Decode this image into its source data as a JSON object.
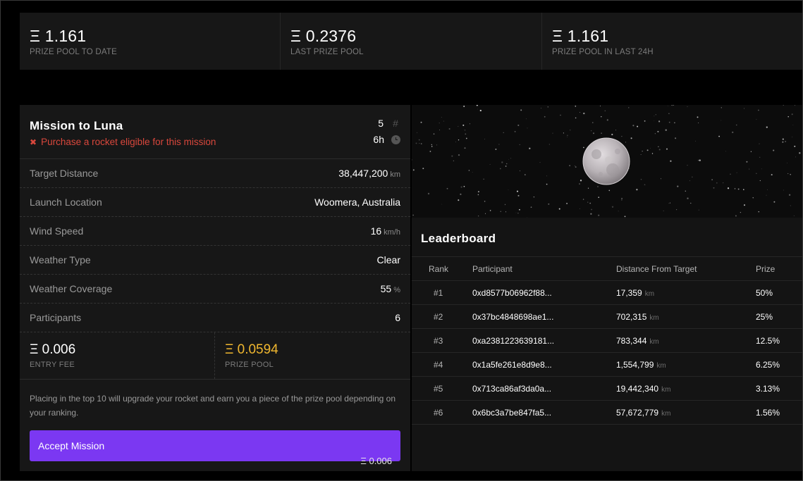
{
  "stats": [
    {
      "value": "Ξ 1.161",
      "label": "PRIZE POOL TO DATE"
    },
    {
      "value": "Ξ 0.2376",
      "label": "LAST PRIZE POOL"
    },
    {
      "value": "Ξ 1.161",
      "label": "PRIZE POOL IN LAST 24H"
    }
  ],
  "mission": {
    "title": "Mission to Luna",
    "warning": "Purchase a rocket eligible for this mission",
    "count": "5",
    "duration": "6h",
    "rows": [
      {
        "label": "Target Distance",
        "value": "38,447,200",
        "unit": "km"
      },
      {
        "label": "Launch Location",
        "value": "Woomera, Australia",
        "unit": ""
      },
      {
        "label": "Wind Speed",
        "value": "16",
        "unit": "km/h"
      },
      {
        "label": "Weather Type",
        "value": "Clear",
        "unit": ""
      },
      {
        "label": "Weather Coverage",
        "value": "55",
        "unit": "%"
      },
      {
        "label": "Participants",
        "value": "6",
        "unit": ""
      }
    ],
    "entry_fee": {
      "value": "Ξ 0.006",
      "label": "ENTRY FEE"
    },
    "prize_pool": {
      "value": "Ξ 0.0594",
      "label": "PRIZE POOL"
    },
    "description": "Placing in the top 10 will upgrade your rocket and earn you a piece of the prize pool depending on your ranking.",
    "accept_label": "Accept Mission",
    "accept_price": "Ξ 0.006"
  },
  "leaderboard": {
    "title": "Leaderboard",
    "columns": [
      "Rank",
      "Participant",
      "Distance From Target",
      "Prize"
    ],
    "rows": [
      {
        "rank": "#1",
        "participant": "0xd8577b06962f88...",
        "distance": "17,359",
        "unit": "km",
        "prize": "50%"
      },
      {
        "rank": "#2",
        "participant": "0x37bc4848698ae1...",
        "distance": "702,315",
        "unit": "km",
        "prize": "25%"
      },
      {
        "rank": "#3",
        "participant": "0xa2381223639181...",
        "distance": "783,344",
        "unit": "km",
        "prize": "12.5%"
      },
      {
        "rank": "#4",
        "participant": "0x1a5fe261e8d9e8...",
        "distance": "1,554,799",
        "unit": "km",
        "prize": "6.25%"
      },
      {
        "rank": "#5",
        "participant": "0x713ca86af3da0a...",
        "distance": "19,442,340",
        "unit": "km",
        "prize": "3.13%"
      },
      {
        "rank": "#6",
        "participant": "0x6bc3a7be847fa5...",
        "distance": "57,672,779",
        "unit": "km",
        "prize": "1.56%"
      }
    ]
  },
  "colors": {
    "accent": "#7b38f2",
    "gold": "#f0b72f",
    "warning": "#d9473c"
  },
  "icons": {
    "count": "hash-icon",
    "duration": "clock-icon",
    "warning": "x-icon"
  }
}
